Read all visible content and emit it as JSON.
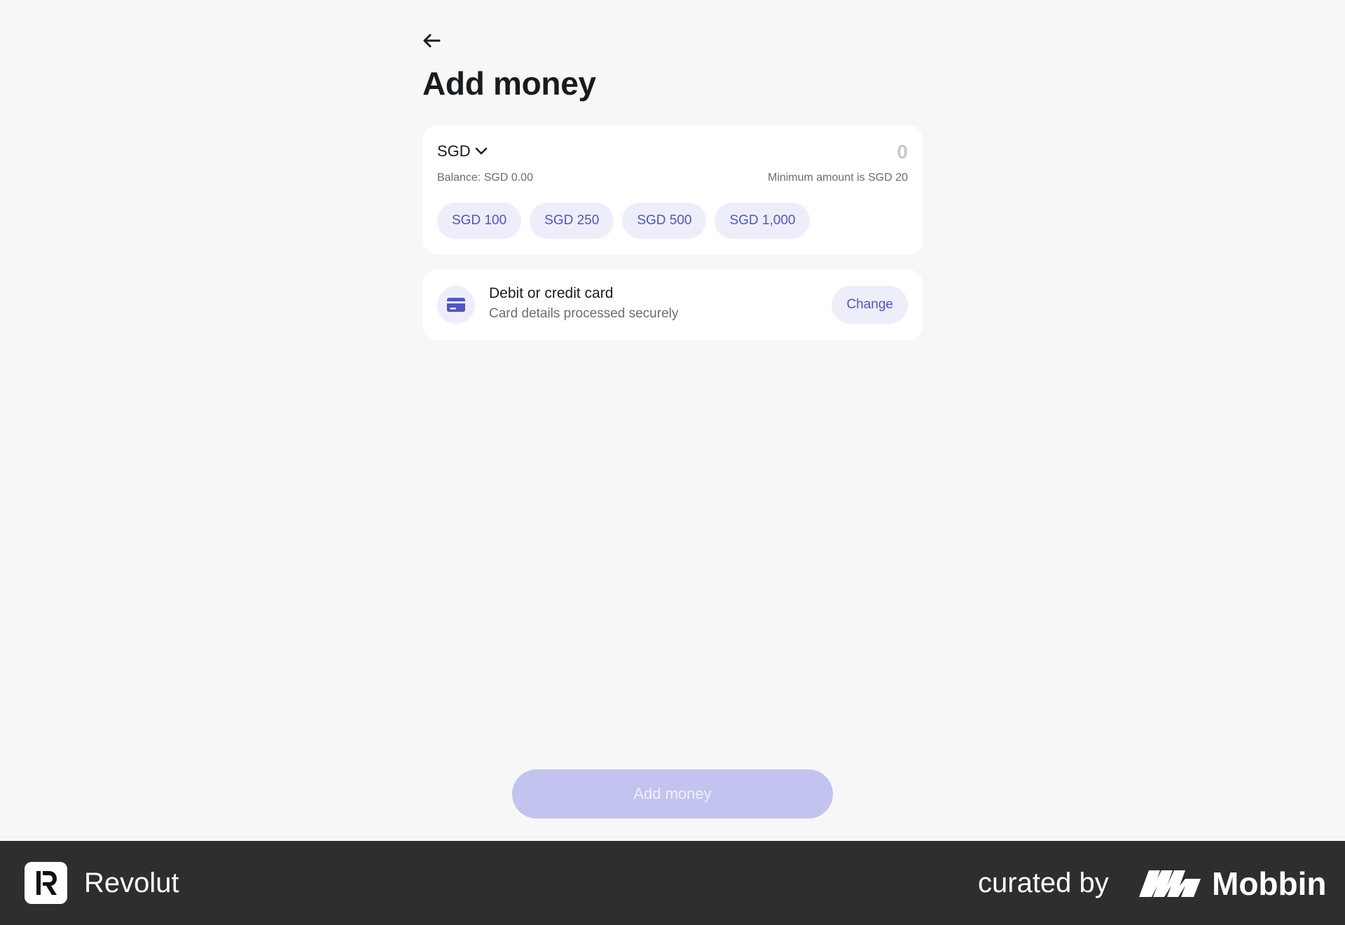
{
  "page": {
    "title": "Add money"
  },
  "amount": {
    "currency": "SGD",
    "value_placeholder": "0",
    "balance": "Balance: SGD 0.00",
    "minimum": "Minimum amount is SGD 20",
    "quick_amounts": [
      "SGD 100",
      "SGD 250",
      "SGD 500",
      "SGD 1,000"
    ]
  },
  "payment_method": {
    "title": "Debit or credit card",
    "subtitle": "Card details processed securely",
    "change_label": "Change",
    "icon": "credit-card-icon"
  },
  "submit": {
    "label": "Add money",
    "enabled": false
  },
  "footer": {
    "app_name": "Revolut",
    "curated_label": "curated by",
    "curator_name": "Mobbin"
  },
  "colors": {
    "background": "#f7f7f7",
    "accent": "#4f55c7",
    "chip_bg": "#eeeefb",
    "submit_disabled": "#c3c3f0",
    "footer_bg": "#2e2e2e"
  }
}
